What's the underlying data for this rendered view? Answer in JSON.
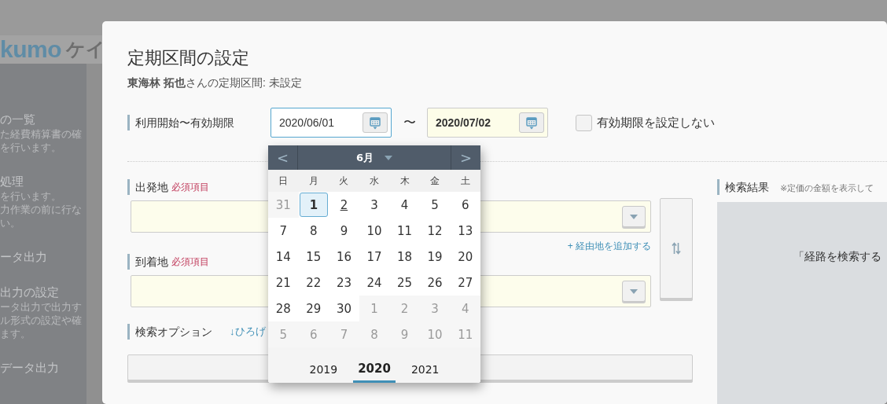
{
  "background": {
    "logo": "kumo",
    "logo_suffix": "ケイ",
    "sidebar_items": [
      {
        "title": "の一覧",
        "lines": [
          "た経費精算書の確",
          "を行います。"
        ]
      },
      {
        "title": "処理",
        "lines": [
          "を行います。",
          "力作業の前に行な",
          "い。"
        ]
      },
      {
        "title": "ータ出力"
      },
      {
        "title": "出力の設定",
        "lines": [
          "ータ出力で出力す",
          "ル形式の設定や確",
          "ます。"
        ]
      },
      {
        "title": "データ出力"
      }
    ]
  },
  "dialog": {
    "title": "定期区間の設定",
    "subtitle": "**東海林 拓也**さんの定期区間: 未設定",
    "period": {
      "label": "利用開始〜有効期限",
      "start": {
        "value": "2020/06/01",
        "focused": true
      },
      "separator": "〜",
      "end": {
        "value": "2020/07/02",
        "focused": false
      },
      "no_expiry": {
        "label": "有効期限を設定しない",
        "checked": false
      }
    },
    "departure": {
      "label": "出発地",
      "required": "必須項目"
    },
    "add_via": "+ 経由地を追加する",
    "arrival": {
      "label": "到着地",
      "required": "必須項目"
    },
    "options": {
      "label": "検索オプション",
      "toggle": "↓ひろげ"
    },
    "results": {
      "label": "検索結果",
      "note": "※定価の金額を表示して",
      "message": "「経路を検索する"
    }
  },
  "calendar": {
    "month": "6月",
    "prev": "<",
    "next": ">",
    "weekdays": [
      "日",
      "月",
      "火",
      "水",
      "木",
      "金",
      "土"
    ],
    "days": [
      {
        "label": "31",
        "kind": "prev",
        "selected": false,
        "today": false
      },
      {
        "label": "1",
        "kind": "current",
        "selected": true,
        "today": false
      },
      {
        "label": "2",
        "kind": "current",
        "selected": false,
        "today": true
      },
      {
        "label": "3",
        "kind": "current",
        "selected": false,
        "today": false
      },
      {
        "label": "4",
        "kind": "current",
        "selected": false,
        "today": false
      },
      {
        "label": "5",
        "kind": "current",
        "selected": false,
        "today": false
      },
      {
        "label": "6",
        "kind": "current",
        "selected": false,
        "today": false
      },
      {
        "label": "7",
        "kind": "current",
        "selected": false,
        "today": false
      },
      {
        "label": "8",
        "kind": "current",
        "selected": false,
        "today": false
      },
      {
        "label": "9",
        "kind": "current",
        "selected": false,
        "today": false
      },
      {
        "label": "10",
        "kind": "current",
        "selected": false,
        "today": false
      },
      {
        "label": "11",
        "kind": "current",
        "selected": false,
        "today": false
      },
      {
        "label": "12",
        "kind": "current",
        "selected": false,
        "today": false
      },
      {
        "label": "13",
        "kind": "current",
        "selected": false,
        "today": false
      },
      {
        "label": "14",
        "kind": "current",
        "selected": false,
        "today": false
      },
      {
        "label": "15",
        "kind": "current",
        "selected": false,
        "today": false
      },
      {
        "label": "16",
        "kind": "current",
        "selected": false,
        "today": false
      },
      {
        "label": "17",
        "kind": "current",
        "selected": false,
        "today": false
      },
      {
        "label": "18",
        "kind": "current",
        "selected": false,
        "today": false
      },
      {
        "label": "19",
        "kind": "current",
        "selected": false,
        "today": false
      },
      {
        "label": "20",
        "kind": "current",
        "selected": false,
        "today": false
      },
      {
        "label": "21",
        "kind": "current",
        "selected": false,
        "today": false
      },
      {
        "label": "22",
        "kind": "current",
        "selected": false,
        "today": false
      },
      {
        "label": "23",
        "kind": "current",
        "selected": false,
        "today": false
      },
      {
        "label": "24",
        "kind": "current",
        "selected": false,
        "today": false
      },
      {
        "label": "25",
        "kind": "current",
        "selected": false,
        "today": false
      },
      {
        "label": "26",
        "kind": "current",
        "selected": false,
        "today": false
      },
      {
        "label": "27",
        "kind": "current",
        "selected": false,
        "today": false
      },
      {
        "label": "28",
        "kind": "current",
        "selected": false,
        "today": false
      },
      {
        "label": "29",
        "kind": "current",
        "selected": false,
        "today": false
      },
      {
        "label": "30",
        "kind": "current",
        "selected": false,
        "today": false
      },
      {
        "label": "1",
        "kind": "next",
        "selected": false,
        "today": false
      },
      {
        "label": "2",
        "kind": "next",
        "selected": false,
        "today": false
      },
      {
        "label": "3",
        "kind": "next",
        "selected": false,
        "today": false
      },
      {
        "label": "4",
        "kind": "next",
        "selected": false,
        "today": false
      },
      {
        "label": "5",
        "kind": "next",
        "selected": false,
        "today": false
      },
      {
        "label": "6",
        "kind": "next",
        "selected": false,
        "today": false
      },
      {
        "label": "7",
        "kind": "next",
        "selected": false,
        "today": false
      },
      {
        "label": "8",
        "kind": "next",
        "selected": false,
        "today": false
      },
      {
        "label": "9",
        "kind": "next",
        "selected": false,
        "today": false
      },
      {
        "label": "10",
        "kind": "next",
        "selected": false,
        "today": false
      },
      {
        "label": "11",
        "kind": "next",
        "selected": false,
        "today": false
      }
    ],
    "years": [
      {
        "label": "2019",
        "selected": false
      },
      {
        "label": "2020",
        "selected": true
      },
      {
        "label": "2021",
        "selected": false
      }
    ]
  }
}
